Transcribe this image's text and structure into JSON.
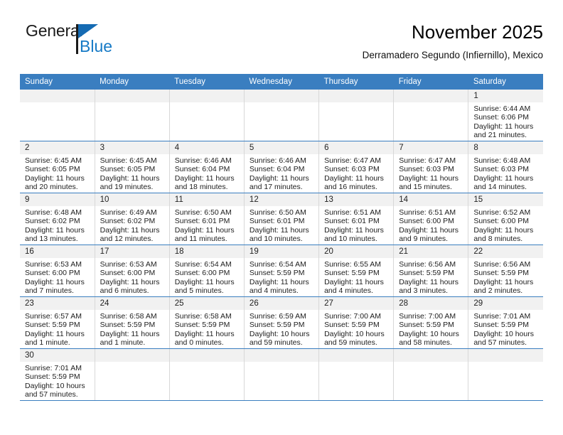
{
  "brand": {
    "name_top": "General",
    "name_bottom": "Blue",
    "accent_color": "#167ac6",
    "triangle_color": "#156bb3"
  },
  "header": {
    "title": "November 2025",
    "subtitle": "Derramadero Segundo (Infiernillo), Mexico",
    "header_bg": "#3a7ec0",
    "daynum_bg": "#f1f1f1",
    "week_separator_color": "#3a7ec0"
  },
  "weekday_headers": [
    "Sunday",
    "Monday",
    "Tuesday",
    "Wednesday",
    "Thursday",
    "Friday",
    "Saturday"
  ],
  "weeks": [
    [
      {
        "day": "",
        "sunrise": "",
        "sunset": "",
        "daylight": "",
        "daylight2": ""
      },
      {
        "day": "",
        "sunrise": "",
        "sunset": "",
        "daylight": "",
        "daylight2": ""
      },
      {
        "day": "",
        "sunrise": "",
        "sunset": "",
        "daylight": "",
        "daylight2": ""
      },
      {
        "day": "",
        "sunrise": "",
        "sunset": "",
        "daylight": "",
        "daylight2": ""
      },
      {
        "day": "",
        "sunrise": "",
        "sunset": "",
        "daylight": "",
        "daylight2": ""
      },
      {
        "day": "",
        "sunrise": "",
        "sunset": "",
        "daylight": "",
        "daylight2": ""
      },
      {
        "day": "1",
        "sunrise": "Sunrise: 6:44 AM",
        "sunset": "Sunset: 6:06 PM",
        "daylight": "Daylight: 11 hours",
        "daylight2": "and 21 minutes."
      }
    ],
    [
      {
        "day": "2",
        "sunrise": "Sunrise: 6:45 AM",
        "sunset": "Sunset: 6:05 PM",
        "daylight": "Daylight: 11 hours",
        "daylight2": "and 20 minutes."
      },
      {
        "day": "3",
        "sunrise": "Sunrise: 6:45 AM",
        "sunset": "Sunset: 6:05 PM",
        "daylight": "Daylight: 11 hours",
        "daylight2": "and 19 minutes."
      },
      {
        "day": "4",
        "sunrise": "Sunrise: 6:46 AM",
        "sunset": "Sunset: 6:04 PM",
        "daylight": "Daylight: 11 hours",
        "daylight2": "and 18 minutes."
      },
      {
        "day": "5",
        "sunrise": "Sunrise: 6:46 AM",
        "sunset": "Sunset: 6:04 PM",
        "daylight": "Daylight: 11 hours",
        "daylight2": "and 17 minutes."
      },
      {
        "day": "6",
        "sunrise": "Sunrise: 6:47 AM",
        "sunset": "Sunset: 6:03 PM",
        "daylight": "Daylight: 11 hours",
        "daylight2": "and 16 minutes."
      },
      {
        "day": "7",
        "sunrise": "Sunrise: 6:47 AM",
        "sunset": "Sunset: 6:03 PM",
        "daylight": "Daylight: 11 hours",
        "daylight2": "and 15 minutes."
      },
      {
        "day": "8",
        "sunrise": "Sunrise: 6:48 AM",
        "sunset": "Sunset: 6:03 PM",
        "daylight": "Daylight: 11 hours",
        "daylight2": "and 14 minutes."
      }
    ],
    [
      {
        "day": "9",
        "sunrise": "Sunrise: 6:48 AM",
        "sunset": "Sunset: 6:02 PM",
        "daylight": "Daylight: 11 hours",
        "daylight2": "and 13 minutes."
      },
      {
        "day": "10",
        "sunrise": "Sunrise: 6:49 AM",
        "sunset": "Sunset: 6:02 PM",
        "daylight": "Daylight: 11 hours",
        "daylight2": "and 12 minutes."
      },
      {
        "day": "11",
        "sunrise": "Sunrise: 6:50 AM",
        "sunset": "Sunset: 6:01 PM",
        "daylight": "Daylight: 11 hours",
        "daylight2": "and 11 minutes."
      },
      {
        "day": "12",
        "sunrise": "Sunrise: 6:50 AM",
        "sunset": "Sunset: 6:01 PM",
        "daylight": "Daylight: 11 hours",
        "daylight2": "and 10 minutes."
      },
      {
        "day": "13",
        "sunrise": "Sunrise: 6:51 AM",
        "sunset": "Sunset: 6:01 PM",
        "daylight": "Daylight: 11 hours",
        "daylight2": "and 10 minutes."
      },
      {
        "day": "14",
        "sunrise": "Sunrise: 6:51 AM",
        "sunset": "Sunset: 6:00 PM",
        "daylight": "Daylight: 11 hours",
        "daylight2": "and 9 minutes."
      },
      {
        "day": "15",
        "sunrise": "Sunrise: 6:52 AM",
        "sunset": "Sunset: 6:00 PM",
        "daylight": "Daylight: 11 hours",
        "daylight2": "and 8 minutes."
      }
    ],
    [
      {
        "day": "16",
        "sunrise": "Sunrise: 6:53 AM",
        "sunset": "Sunset: 6:00 PM",
        "daylight": "Daylight: 11 hours",
        "daylight2": "and 7 minutes."
      },
      {
        "day": "17",
        "sunrise": "Sunrise: 6:53 AM",
        "sunset": "Sunset: 6:00 PM",
        "daylight": "Daylight: 11 hours",
        "daylight2": "and 6 minutes."
      },
      {
        "day": "18",
        "sunrise": "Sunrise: 6:54 AM",
        "sunset": "Sunset: 6:00 PM",
        "daylight": "Daylight: 11 hours",
        "daylight2": "and 5 minutes."
      },
      {
        "day": "19",
        "sunrise": "Sunrise: 6:54 AM",
        "sunset": "Sunset: 5:59 PM",
        "daylight": "Daylight: 11 hours",
        "daylight2": "and 4 minutes."
      },
      {
        "day": "20",
        "sunrise": "Sunrise: 6:55 AM",
        "sunset": "Sunset: 5:59 PM",
        "daylight": "Daylight: 11 hours",
        "daylight2": "and 4 minutes."
      },
      {
        "day": "21",
        "sunrise": "Sunrise: 6:56 AM",
        "sunset": "Sunset: 5:59 PM",
        "daylight": "Daylight: 11 hours",
        "daylight2": "and 3 minutes."
      },
      {
        "day": "22",
        "sunrise": "Sunrise: 6:56 AM",
        "sunset": "Sunset: 5:59 PM",
        "daylight": "Daylight: 11 hours",
        "daylight2": "and 2 minutes."
      }
    ],
    [
      {
        "day": "23",
        "sunrise": "Sunrise: 6:57 AM",
        "sunset": "Sunset: 5:59 PM",
        "daylight": "Daylight: 11 hours",
        "daylight2": "and 1 minute."
      },
      {
        "day": "24",
        "sunrise": "Sunrise: 6:58 AM",
        "sunset": "Sunset: 5:59 PM",
        "daylight": "Daylight: 11 hours",
        "daylight2": "and 1 minute."
      },
      {
        "day": "25",
        "sunrise": "Sunrise: 6:58 AM",
        "sunset": "Sunset: 5:59 PM",
        "daylight": "Daylight: 11 hours",
        "daylight2": "and 0 minutes."
      },
      {
        "day": "26",
        "sunrise": "Sunrise: 6:59 AM",
        "sunset": "Sunset: 5:59 PM",
        "daylight": "Daylight: 10 hours",
        "daylight2": "and 59 minutes."
      },
      {
        "day": "27",
        "sunrise": "Sunrise: 7:00 AM",
        "sunset": "Sunset: 5:59 PM",
        "daylight": "Daylight: 10 hours",
        "daylight2": "and 59 minutes."
      },
      {
        "day": "28",
        "sunrise": "Sunrise: 7:00 AM",
        "sunset": "Sunset: 5:59 PM",
        "daylight": "Daylight: 10 hours",
        "daylight2": "and 58 minutes."
      },
      {
        "day": "29",
        "sunrise": "Sunrise: 7:01 AM",
        "sunset": "Sunset: 5:59 PM",
        "daylight": "Daylight: 10 hours",
        "daylight2": "and 57 minutes."
      }
    ],
    [
      {
        "day": "30",
        "sunrise": "Sunrise: 7:01 AM",
        "sunset": "Sunset: 5:59 PM",
        "daylight": "Daylight: 10 hours",
        "daylight2": "and 57 minutes."
      },
      {
        "day": "",
        "sunrise": "",
        "sunset": "",
        "daylight": "",
        "daylight2": ""
      },
      {
        "day": "",
        "sunrise": "",
        "sunset": "",
        "daylight": "",
        "daylight2": ""
      },
      {
        "day": "",
        "sunrise": "",
        "sunset": "",
        "daylight": "",
        "daylight2": ""
      },
      {
        "day": "",
        "sunrise": "",
        "sunset": "",
        "daylight": "",
        "daylight2": ""
      },
      {
        "day": "",
        "sunrise": "",
        "sunset": "",
        "daylight": "",
        "daylight2": ""
      },
      {
        "day": "",
        "sunrise": "",
        "sunset": "",
        "daylight": "",
        "daylight2": ""
      }
    ]
  ]
}
